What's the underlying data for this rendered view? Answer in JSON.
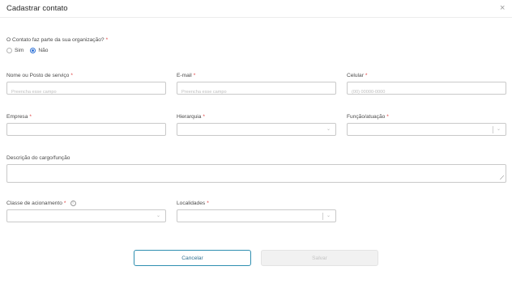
{
  "modal": {
    "title": "Cadastrar contato",
    "close_glyph": "×"
  },
  "org_question": {
    "label": "O Contato faz parte da sua organização?",
    "required_mark": "*",
    "options": [
      {
        "label": "Sim",
        "checked": false
      },
      {
        "label": "Não",
        "checked": true
      }
    ]
  },
  "fields": {
    "name": {
      "label": "Nome ou Posto de serviço",
      "required_mark": "*",
      "placeholder": "Preencha esse campo",
      "value": ""
    },
    "email": {
      "label": "E-mail",
      "required_mark": "*",
      "placeholder": "Preencha esse campo",
      "value": ""
    },
    "phone": {
      "label": "Celular",
      "required_mark": "*",
      "placeholder": "(00) 00000-0000",
      "value": ""
    },
    "company": {
      "label": "Empresa",
      "required_mark": "*",
      "value": ""
    },
    "hierarchy": {
      "label": "Hierarquia",
      "required_mark": "*",
      "value": "",
      "icon": "chevron-down-icon"
    },
    "role": {
      "label": "Função/atuação",
      "required_mark": "*",
      "value": "",
      "icon": "chevron-down-icon"
    },
    "description": {
      "label": "Descrição do cargo/função",
      "value": ""
    },
    "trigger_class": {
      "label": "Classe de acionamento",
      "required_mark": "*",
      "value": "",
      "info_glyph": "i",
      "icon": "chevron-down-icon"
    },
    "locations": {
      "label": "Localidades",
      "required_mark": "*",
      "value": "",
      "icon": "chevron-down-icon"
    }
  },
  "buttons": {
    "cancel": "Cancelar",
    "save": "Salvar"
  },
  "glyphs": {
    "chevron": "⌄",
    "resize": "⟋"
  },
  "colors": {
    "required": "#e03a3a",
    "radio_accent": "#2b6fd6",
    "cancel_border": "#2f8fb0",
    "save_disabled_bg": "#f1f1f1"
  }
}
